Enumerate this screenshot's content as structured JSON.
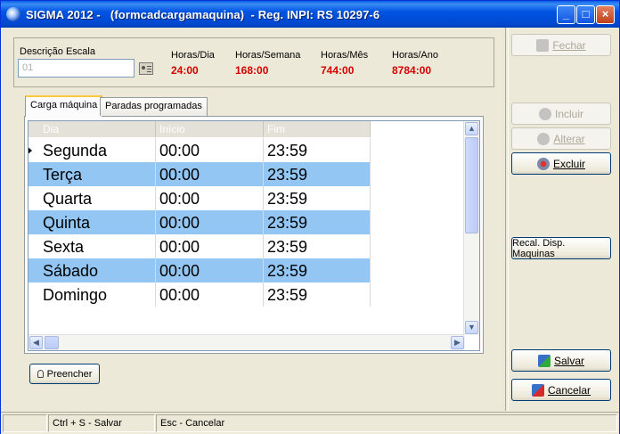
{
  "window": {
    "title": "SIGMA 2012 -   (formcadcargamaquina)  - Reg. INPI: RS 10297-6",
    "minimize": "_",
    "maximize": "□",
    "close": "×"
  },
  "header": {
    "descricao_label": "Descrição Escala",
    "descricao_value": "01",
    "horas_dia_label": "Horas/Dia",
    "horas_dia_value": "24:00",
    "horas_semana_label": "Horas/Semana",
    "horas_semana_value": "168:00",
    "horas_mes_label": "Horas/Mês",
    "horas_mes_value": "744:00",
    "horas_ano_label": "Horas/Ano",
    "horas_ano_value": "8784:00"
  },
  "tabs": [
    {
      "label": "Carga máquina",
      "active": true
    },
    {
      "label": "Paradas programadas",
      "active": false
    }
  ],
  "grid": {
    "columns": [
      "Dia",
      "Início",
      "Fim"
    ],
    "rows": [
      {
        "dia": "Segunda",
        "inicio": "00:00",
        "fim": "23:59"
      },
      {
        "dia": "Terça",
        "inicio": "00:00",
        "fim": "23:59"
      },
      {
        "dia": "Quarta",
        "inicio": "00:00",
        "fim": "23:59"
      },
      {
        "dia": "Quinta",
        "inicio": "00:00",
        "fim": "23:59"
      },
      {
        "dia": "Sexta",
        "inicio": "00:00",
        "fim": "23:59"
      },
      {
        "dia": "Sábado",
        "inicio": "00:00",
        "fim": "23:59"
      },
      {
        "dia": "Domingo",
        "inicio": "00:00",
        "fim": "23:59"
      }
    ]
  },
  "buttons": {
    "fechar": "Fechar",
    "incluir": "Incluir",
    "alterar": "Alterar",
    "excluir": "Excluir",
    "recalc": "Recal. Disp. Maquinas",
    "salvar": "Salvar",
    "cancelar": "Cancelar",
    "preencher": "Preencher"
  },
  "statusbar": {
    "panel1": "",
    "panel2": "Ctrl + S - Salvar",
    "panel3": "Esc - Cancelar"
  },
  "colors": {
    "accent": "#0054e3",
    "value_red": "#d40000",
    "row_alt": "#93c6f3"
  }
}
